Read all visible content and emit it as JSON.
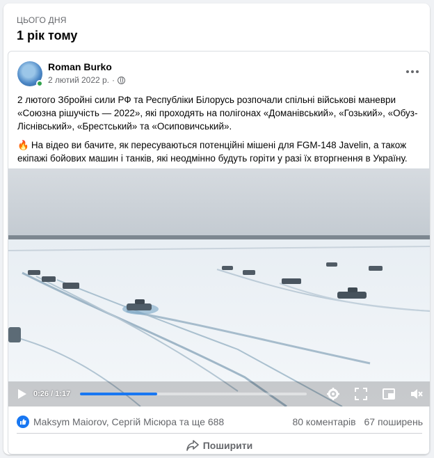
{
  "memory": {
    "kicker": "ЦЬОГО ДНЯ",
    "title": "1 рік тому"
  },
  "post": {
    "author": "Roman Burko",
    "date": "2 лютий 2022 р.",
    "separator": "·",
    "paragraph1": "2 лютого Збройні сили РФ та Республіки Білорусь розпочали спільні військові маневри «Союзна рішучість — 2022», які проходять на полігонах «Доманівський», «Гозький», «Обуз-Ліснівський», «Брестський» та «Осиповичський».",
    "paragraph2": "На відео ви бачите, як пересуваються потенційні мішені для FGM-148 Javelin, а також екіпажі бойових машин і танків, які неодмінно будуть горіти у разі їх вторгнення в Україну.",
    "paragraph2_icon": "fire-emoji"
  },
  "video": {
    "time": "0:26 / 1:17",
    "progress": 0.34,
    "accent": "#1877f2"
  },
  "stats": {
    "reactors": "Maksym Maiorov, Сергій Місюра та ще 688",
    "comments": "80 коментарів",
    "shares": "67 поширень"
  },
  "actions": {
    "share_label": "Поширити"
  }
}
